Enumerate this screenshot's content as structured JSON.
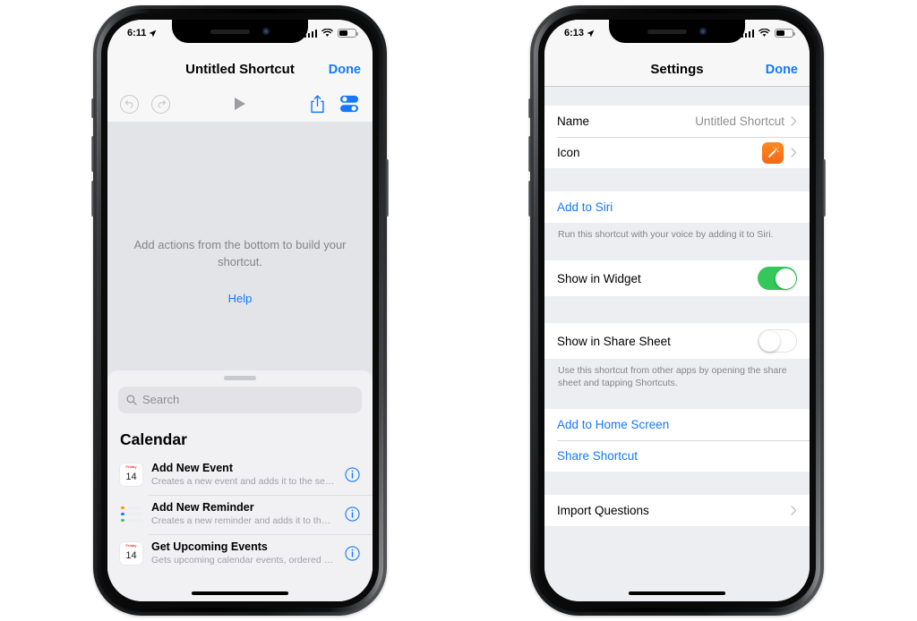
{
  "page": {
    "background": "#ffffff",
    "accent_blue": "#1479ff",
    "toggle_on_color": "#34c759",
    "icon_orange": "#f4671a"
  },
  "left_phone": {
    "status_bar": {
      "time": "6:11",
      "location_icon": "location-arrow-icon",
      "cellular_icon": "cellular-bars-icon",
      "wifi_icon": "wifi-icon",
      "battery_icon": "battery-icon"
    },
    "nav": {
      "title": "Untitled Shortcut",
      "done_label": "Done"
    },
    "toolbar": {
      "undo_icon": "undo-icon",
      "redo_icon": "redo-icon",
      "play_icon": "play-icon",
      "share_icon": "share-icon",
      "settings_icon": "sliders-settings-icon"
    },
    "canvas": {
      "empty_message": "Add actions from the bottom to build your shortcut.",
      "help_label": "Help"
    },
    "sheet": {
      "grabber": "sheet-grabber",
      "search_placeholder": "Search",
      "search_value": "",
      "search_icon": "search-icon",
      "section_title": "Calendar",
      "actions": [
        {
          "title": "Add New Event",
          "subtitle": "Creates a new event and adds it to the sel…",
          "icon": "calendar-icon",
          "icon_top_label": "Friday",
          "icon_day": "14",
          "info_icon": "info-icon"
        },
        {
          "title": "Add New Reminder",
          "subtitle": "Creates a new reminder and adds it to the…",
          "icon": "reminders-icon",
          "info_icon": "info-icon"
        },
        {
          "title": "Get Upcoming Events",
          "subtitle": "Gets upcoming calendar events, ordered fr…",
          "icon": "calendar-icon",
          "icon_top_label": "Friday",
          "icon_day": "14",
          "info_icon": "info-icon"
        }
      ]
    }
  },
  "right_phone": {
    "status_bar": {
      "time": "6:13",
      "location_icon": "location-arrow-icon",
      "cellular_icon": "cellular-bars-icon",
      "wifi_icon": "wifi-icon",
      "battery_icon": "battery-icon"
    },
    "nav": {
      "title": "Settings",
      "done_label": "Done"
    },
    "groups": [
      {
        "rows": [
          {
            "type": "value",
            "label": "Name",
            "value": "Untitled Shortcut",
            "chevron": "chevron-right-icon"
          },
          {
            "type": "icon",
            "label": "Icon",
            "icon": "magic-wand-icon",
            "chevron": "chevron-right-icon"
          }
        ]
      },
      {
        "rows": [
          {
            "type": "link",
            "label": "Add to Siri"
          }
        ],
        "footnote": "Run this shortcut with your voice by adding it to Siri."
      },
      {
        "rows": [
          {
            "type": "toggle",
            "label": "Show in Widget",
            "state": "on"
          }
        ]
      },
      {
        "rows": [
          {
            "type": "toggle",
            "label": "Show in Share Sheet",
            "state": "off"
          }
        ],
        "footnote": "Use this shortcut from other apps by opening the share sheet and tapping Shortcuts."
      },
      {
        "rows": [
          {
            "type": "link",
            "label": "Add to Home Screen"
          },
          {
            "type": "link",
            "label": "Share Shortcut"
          }
        ]
      },
      {
        "rows": [
          {
            "type": "value",
            "label": "Import Questions",
            "value": "",
            "chevron": "chevron-right-icon"
          }
        ]
      }
    ]
  }
}
